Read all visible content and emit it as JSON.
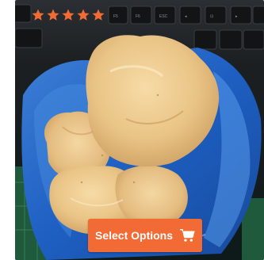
{
  "product_card": {
    "rating": {
      "value": 5,
      "max": 5,
      "star_color": "#f26b35"
    },
    "image": {
      "icon": "product-photo"
    },
    "action": {
      "label": "Select Options",
      "icon": "cart-icon",
      "color": "#f26b35"
    }
  }
}
